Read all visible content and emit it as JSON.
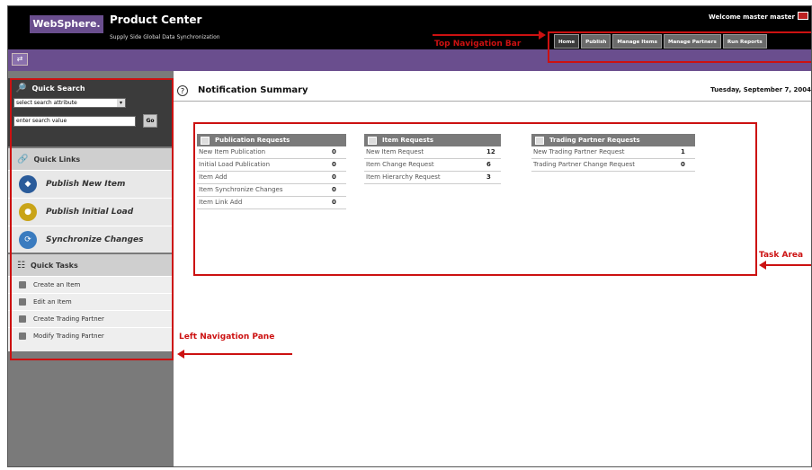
{
  "header": {
    "logo_label": "WebSphere.",
    "product_name": "Product Center",
    "product_subtitle": "Supply Side Global Data Synchronization",
    "welcome_text": "Welcome  master master",
    "nav_tabs": [
      {
        "label": "Home",
        "active": true
      },
      {
        "label": "Publish",
        "active": false
      },
      {
        "label": "Manage Items",
        "active": false
      },
      {
        "label": "Manage Partners",
        "active": false
      },
      {
        "label": "Run Reports",
        "active": false
      }
    ]
  },
  "left_nav": {
    "quick_search": {
      "title": "Quick Search",
      "select_value": "select search attribute",
      "input_value": "enter search value",
      "go_label": "Go"
    },
    "quick_links": {
      "title": "Quick Links",
      "items": [
        {
          "label": "Publish New Item",
          "icon": "publish-icon"
        },
        {
          "label": "Publish Initial Load",
          "icon": "load-icon"
        },
        {
          "label": "Synchronize Changes",
          "icon": "sync-icon"
        }
      ]
    },
    "quick_tasks": {
      "title": "Quick Tasks",
      "items": [
        {
          "label": "Create an Item"
        },
        {
          "label": "Edit an Item"
        },
        {
          "label": "Create Trading Partner"
        },
        {
          "label": "Modify Trading Partner"
        }
      ]
    }
  },
  "main": {
    "title": "Notification Summary",
    "date": "Tuesday, September 7, 2004",
    "publication_requests": {
      "title": "Publication Requests",
      "rows": [
        {
          "label": "New Item Publication",
          "count": "0"
        },
        {
          "label": "Initial Load Publication",
          "count": "0"
        },
        {
          "label": "Item Add",
          "count": "0"
        },
        {
          "label": "Item Synchronize Changes",
          "count": "0"
        },
        {
          "label": "Item Link Add",
          "count": "0"
        }
      ]
    },
    "item_requests": {
      "title": "Item Requests",
      "rows": [
        {
          "label": "New Item Request",
          "count": "12"
        },
        {
          "label": "Item Change Request",
          "count": "6"
        },
        {
          "label": "Item Hierarchy Request",
          "count": "3"
        }
      ]
    },
    "trading_partner_requests": {
      "title": "Trading Partner Requests",
      "rows": [
        {
          "label": "New Trading Partner Request",
          "count": "1"
        },
        {
          "label": "Trading Partner Change Request",
          "count": "0"
        }
      ]
    }
  },
  "annotations": {
    "top_nav": "Top Navigation Bar",
    "task_area": "Task Area",
    "left_nav": "Left Navigation Pane"
  },
  "colors": {
    "accent_purple": "#6a4e8e",
    "annotation_red": "#cc1111",
    "header_black": "#000000",
    "pane_gray": "#7a7a7a"
  }
}
